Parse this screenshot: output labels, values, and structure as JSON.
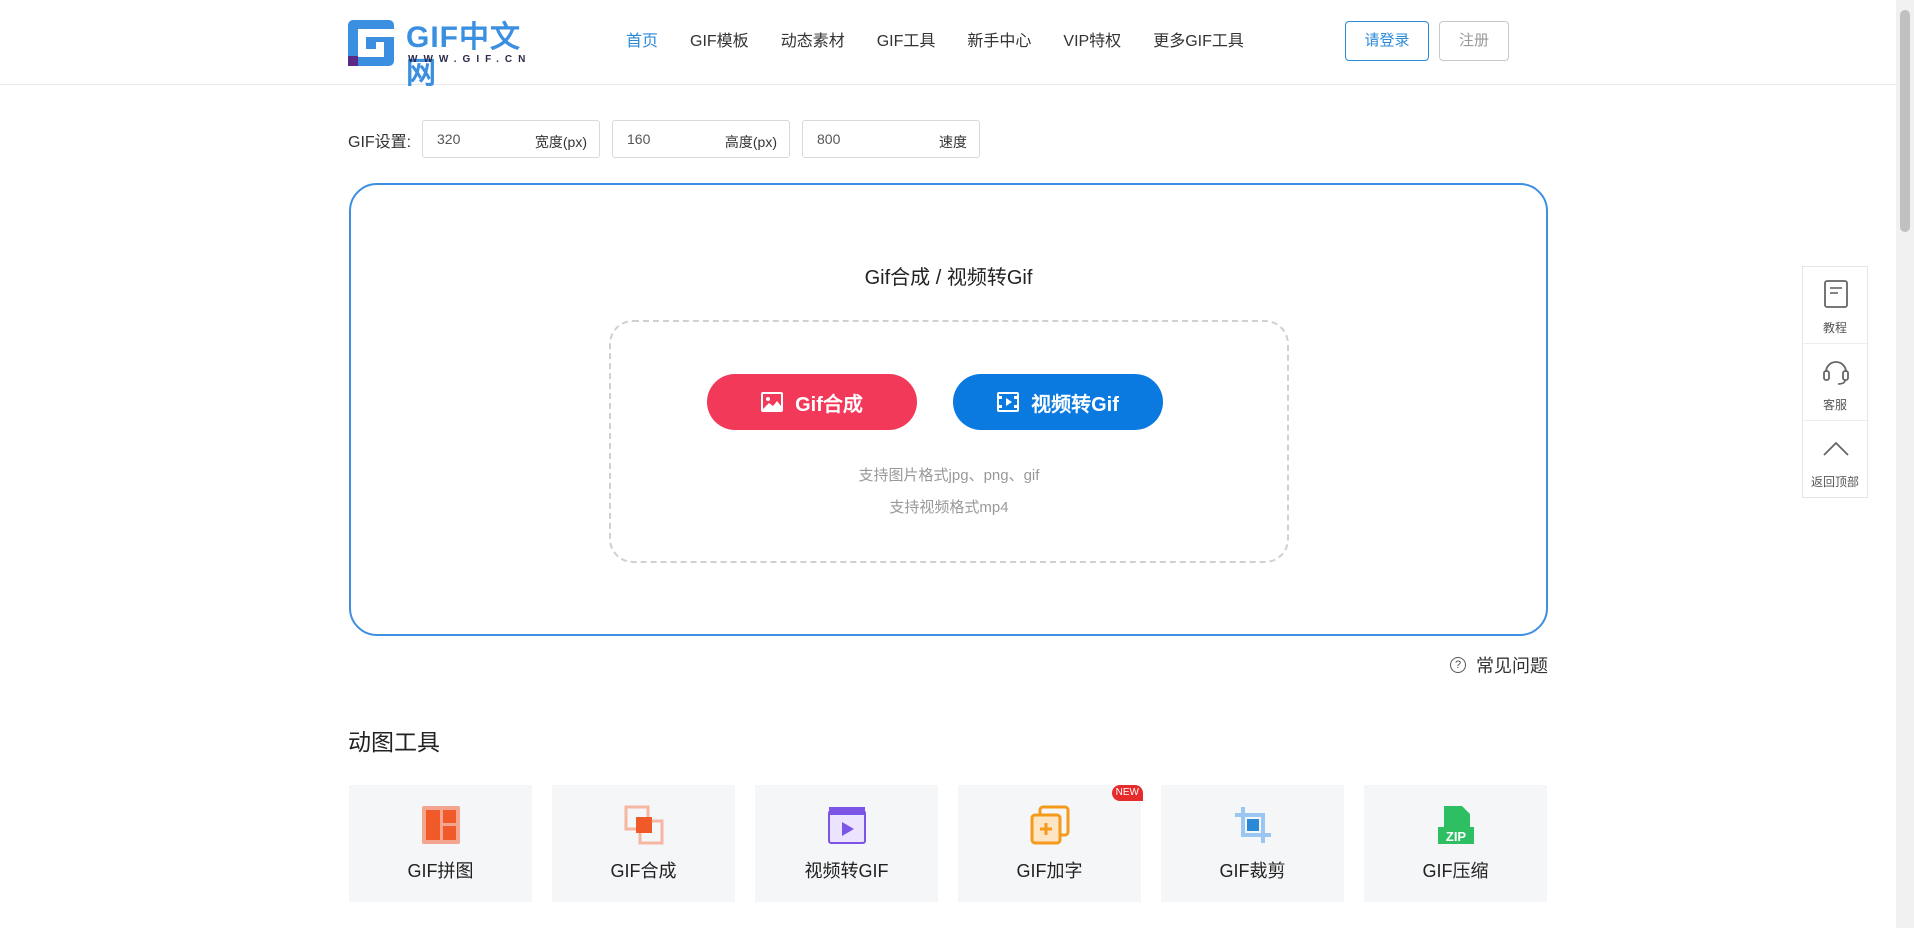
{
  "header": {
    "logo_brand": "GIF中文网",
    "logo_sub": "WWW.GIF.CN",
    "nav": [
      {
        "label": "首页",
        "active": true
      },
      {
        "label": "GIF模板"
      },
      {
        "label": "动态素材"
      },
      {
        "label": "GIF工具"
      },
      {
        "label": "新手中心"
      },
      {
        "label": "VIP特权"
      },
      {
        "label": "更多GIF工具"
      }
    ],
    "login_label": "请登录",
    "register_label": "注册"
  },
  "settings": {
    "label": "GIF设置:",
    "width": {
      "value": "320",
      "unit": "宽度(px)"
    },
    "height": {
      "value": "160",
      "unit": "高度(px)"
    },
    "speed": {
      "value": "800",
      "unit": "速度"
    }
  },
  "panel": {
    "title": "Gif合成 / 视频转Gif",
    "gif_button": "Gif合成",
    "video_button": "视频转Gif",
    "hint_image": "支持图片格式jpg、png、gif",
    "hint_video": "支持视频格式mp4"
  },
  "faq_label": "常见问题",
  "tools_section": {
    "title": "动图工具",
    "items": [
      {
        "label": "GIF拼图",
        "icon": "collage-icon"
      },
      {
        "label": "GIF合成",
        "icon": "merge-icon"
      },
      {
        "label": "视频转GIF",
        "icon": "video-icon"
      },
      {
        "label": "GIF加字",
        "icon": "add-text-icon",
        "badge": "NEW"
      },
      {
        "label": "GIF裁剪",
        "icon": "crop-icon"
      },
      {
        "label": "GIF压缩",
        "icon": "zip-icon"
      }
    ]
  },
  "sidebar": {
    "items": [
      {
        "label": "教程",
        "icon": "tutorial-book-icon"
      },
      {
        "label": "客服",
        "icon": "headset-icon"
      },
      {
        "label": "返回顶部",
        "icon": "chevron-up-icon"
      }
    ]
  },
  "colors": {
    "accent_blue": "#2b8ad8",
    "gif_button": "#f2395a",
    "video_button": "#0b7ae0",
    "panel_border": "#3d8fe2"
  }
}
